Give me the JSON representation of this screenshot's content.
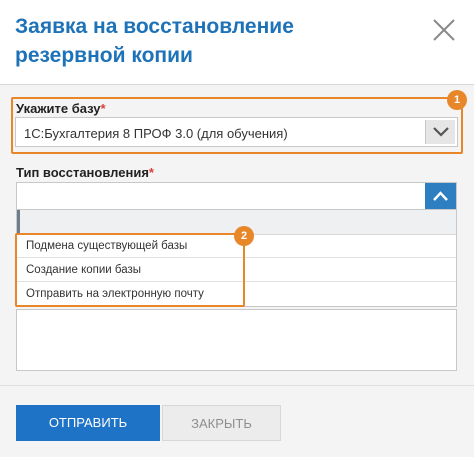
{
  "dialog": {
    "title": "Заявка на восстановление резервной копии"
  },
  "base_field": {
    "label": "Укажите базу",
    "required_mark": "*",
    "value": "1С:Бухгалтерия 8 ПРОФ 3.0 (для обучения)",
    "callout_number": "1"
  },
  "restore_field": {
    "label": "Тип восстановления",
    "required_mark": "*",
    "options": [
      "Подмена существующей базы",
      "Создание копии базы",
      "Отправить на электронную почту"
    ],
    "callout_number": "2"
  },
  "footer": {
    "submit_label": "ОТПРАВИТЬ",
    "close_label": "ЗАКРЫТЬ"
  },
  "colors": {
    "title": "#1e73b8",
    "accent": "#e8862a",
    "primary_button": "#1e73c7",
    "required": "#e23b3b"
  }
}
